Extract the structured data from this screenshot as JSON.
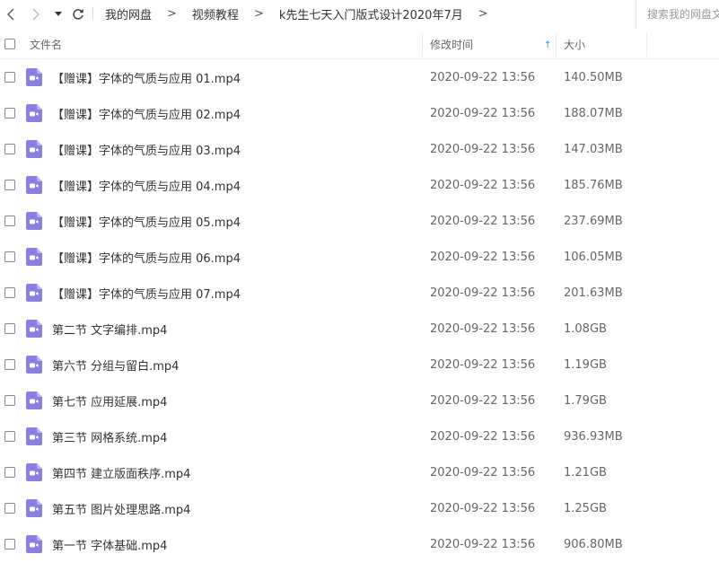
{
  "nav": {
    "back_icon": "chevron-left-icon",
    "forward_icon": "chevron-right-icon",
    "dropdown_icon": "caret-down-icon",
    "refresh_icon": "refresh-icon"
  },
  "breadcrumb": {
    "items": [
      "我的网盘",
      "视频教程",
      "k先生七天入门版式设计2020年7月"
    ],
    "separator": ">"
  },
  "search": {
    "placeholder": "搜索我的网盘文件"
  },
  "columns": {
    "name": "文件名",
    "modified": "修改时间",
    "size": "大小",
    "sort_arrow": "↑"
  },
  "colors": {
    "accent": "#1e90ff",
    "file_icon": "#8a7fe3"
  },
  "files": [
    {
      "name": "【赠课】字体的气质与应用 01.mp4",
      "modified": "2020-09-22 13:56",
      "size": "140.50MB",
      "icon": "video-file-icon"
    },
    {
      "name": "【赠课】字体的气质与应用 02.mp4",
      "modified": "2020-09-22 13:56",
      "size": "188.07MB",
      "icon": "video-file-icon"
    },
    {
      "name": "【赠课】字体的气质与应用 03.mp4",
      "modified": "2020-09-22 13:56",
      "size": "147.03MB",
      "icon": "video-file-icon"
    },
    {
      "name": "【赠课】字体的气质与应用 04.mp4",
      "modified": "2020-09-22 13:56",
      "size": "185.76MB",
      "icon": "video-file-icon"
    },
    {
      "name": "【赠课】字体的气质与应用 05.mp4",
      "modified": "2020-09-22 13:56",
      "size": "237.69MB",
      "icon": "video-file-icon"
    },
    {
      "name": "【赠课】字体的气质与应用 06.mp4",
      "modified": "2020-09-22 13:56",
      "size": "106.05MB",
      "icon": "video-file-icon"
    },
    {
      "name": "【赠课】字体的气质与应用 07.mp4",
      "modified": "2020-09-22 13:56",
      "size": "201.63MB",
      "icon": "video-file-icon"
    },
    {
      "name": "第二节 文字编排.mp4",
      "modified": "2020-09-22 13:56",
      "size": "1.08GB",
      "icon": "video-file-icon"
    },
    {
      "name": "第六节 分组与留白.mp4",
      "modified": "2020-09-22 13:56",
      "size": "1.19GB",
      "icon": "video-file-icon"
    },
    {
      "name": "第七节 应用延展.mp4",
      "modified": "2020-09-22 13:56",
      "size": "1.79GB",
      "icon": "video-file-icon"
    },
    {
      "name": "第三节 网格系统.mp4",
      "modified": "2020-09-22 13:56",
      "size": "936.93MB",
      "icon": "video-file-icon"
    },
    {
      "name": "第四节 建立版面秩序.mp4",
      "modified": "2020-09-22 13:56",
      "size": "1.21GB",
      "icon": "video-file-icon"
    },
    {
      "name": "第五节 图片处理思路.mp4",
      "modified": "2020-09-22 13:56",
      "size": "1.25GB",
      "icon": "video-file-icon"
    },
    {
      "name": "第一节 字体基础.mp4",
      "modified": "2020-09-22 13:56",
      "size": "906.80MB",
      "icon": "video-file-icon"
    }
  ]
}
